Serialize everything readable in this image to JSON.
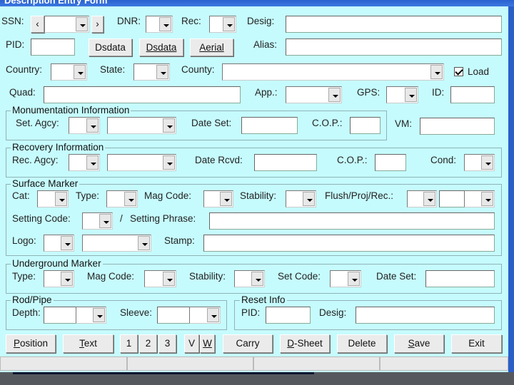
{
  "window": {
    "title": "Description Entry Form"
  },
  "row1": {
    "ssn": "SSN:",
    "prev": "‹",
    "next": "›",
    "dnr": "DNR:",
    "rec": "Rec:",
    "desig": "Desig:"
  },
  "row2": {
    "pid": "PID:",
    "dsdata1": "Dsdata",
    "dsdata2": "Dsdata",
    "aerial": "Aerial",
    "alias": "Alias:"
  },
  "row3": {
    "country": "Country:",
    "state": "State:",
    "county": "County:",
    "load": "Load",
    "load_checked": true
  },
  "row4": {
    "quad": "Quad:",
    "app": "App.:",
    "gps": "GPS:",
    "id": "ID:"
  },
  "monumentation": {
    "title": "Monumentation Information",
    "set_agcy": "Set. Agcy:",
    "date_set": "Date Set:",
    "cop": "C.O.P.:",
    "vm": "VM:"
  },
  "recovery": {
    "title": "Recovery Information",
    "rec_agcy": "Rec. Agcy:",
    "date_rcvd": "Date Rcvd:",
    "cop": "C.O.P.:",
    "cond": "Cond:"
  },
  "surface": {
    "title": "Surface Marker",
    "cat": "Cat:",
    "type": "Type:",
    "mag_code": "Mag Code:",
    "stability": "Stability:",
    "flush": "Flush/Proj/Rec.:",
    "setting_code": "Setting Code:",
    "slash": "/",
    "setting_phrase": "Setting Phrase:",
    "logo": "Logo:",
    "stamp": "Stamp:"
  },
  "underground": {
    "title": "Underground Marker",
    "type": "Type:",
    "mag_code": "Mag Code:",
    "stability": "Stability:",
    "set_code": "Set Code:",
    "date_set": "Date Set:"
  },
  "rod": {
    "title": "Rod/Pipe",
    "depth": "Depth:",
    "sleeve": "Sleeve:"
  },
  "reset": {
    "title": "Reset Info",
    "pid": "PID:",
    "desig": "Desig:"
  },
  "buttons": {
    "position": "Position",
    "text": "Text",
    "p1": "1",
    "p2": "2",
    "p3": "3",
    "v": "V",
    "w": "W",
    "carry": "Carry",
    "dsheet": "D-Sheet",
    "delete": "Delete",
    "save": "Save",
    "exit": "Exit"
  },
  "colors": {
    "form_bg": "#c6fbfd",
    "title_bar": "#2a62d0"
  }
}
